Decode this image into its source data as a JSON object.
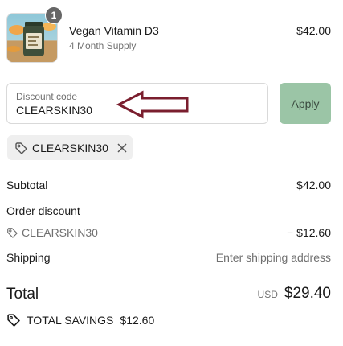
{
  "product": {
    "name": "Vegan Vitamin D3",
    "variant": "4 Month Supply",
    "price": "$42.00",
    "quantity": "1"
  },
  "discount": {
    "label": "Discount code",
    "value": "CLEARSKIN30",
    "apply_label": "Apply",
    "applied_code": "CLEARSKIN30"
  },
  "summary": {
    "subtotal_label": "Subtotal",
    "subtotal_value": "$42.00",
    "order_discount_label": "Order discount",
    "discount_code": "CLEARSKIN30",
    "discount_value": "− $12.60",
    "shipping_label": "Shipping",
    "shipping_value": "Enter shipping address",
    "total_label": "Total",
    "currency": "USD",
    "total_value": "$29.40",
    "savings_label": "TOTAL SAVINGS",
    "savings_value": "$12.60"
  },
  "colors": {
    "apply_button": "#9bc5a6",
    "annotation_arrow": "#7a1e2e"
  },
  "icons": [
    "product-image",
    "tag-icon",
    "close-icon",
    "arrow-annotation"
  ]
}
